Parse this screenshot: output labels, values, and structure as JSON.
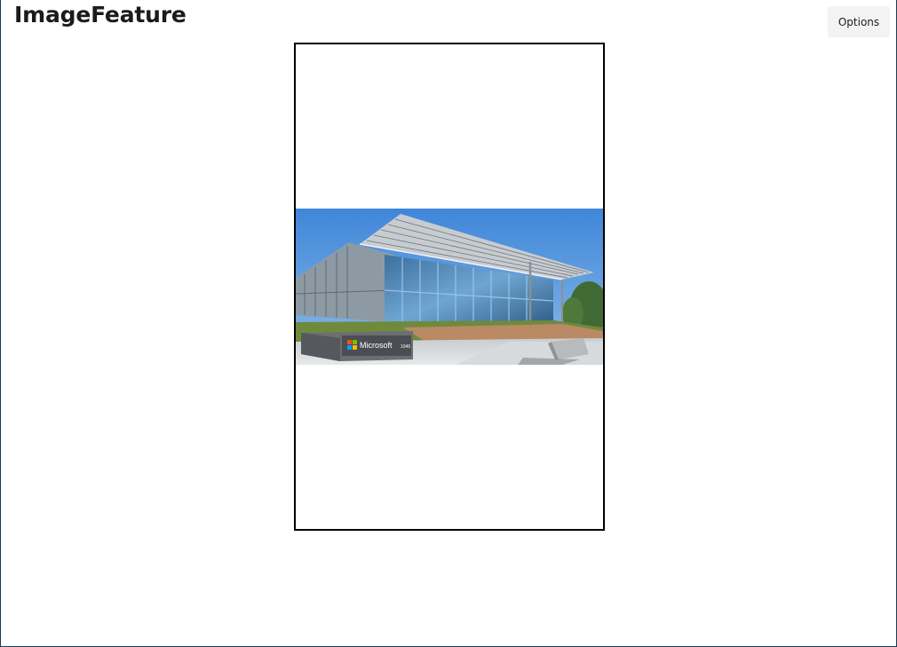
{
  "app": {
    "title": "ImageFeature"
  },
  "toolbar": {
    "options_label": "Options"
  },
  "image": {
    "subject": "Microsoft office building with glass facade and solar canopy",
    "sign_text": "Microsoft",
    "sign_number": "1045"
  },
  "colors": {
    "frame_border": "#000000",
    "sky": "#4d8fd6",
    "button_bg": "#f3f3f3",
    "window_border": "#1f3a4f"
  }
}
